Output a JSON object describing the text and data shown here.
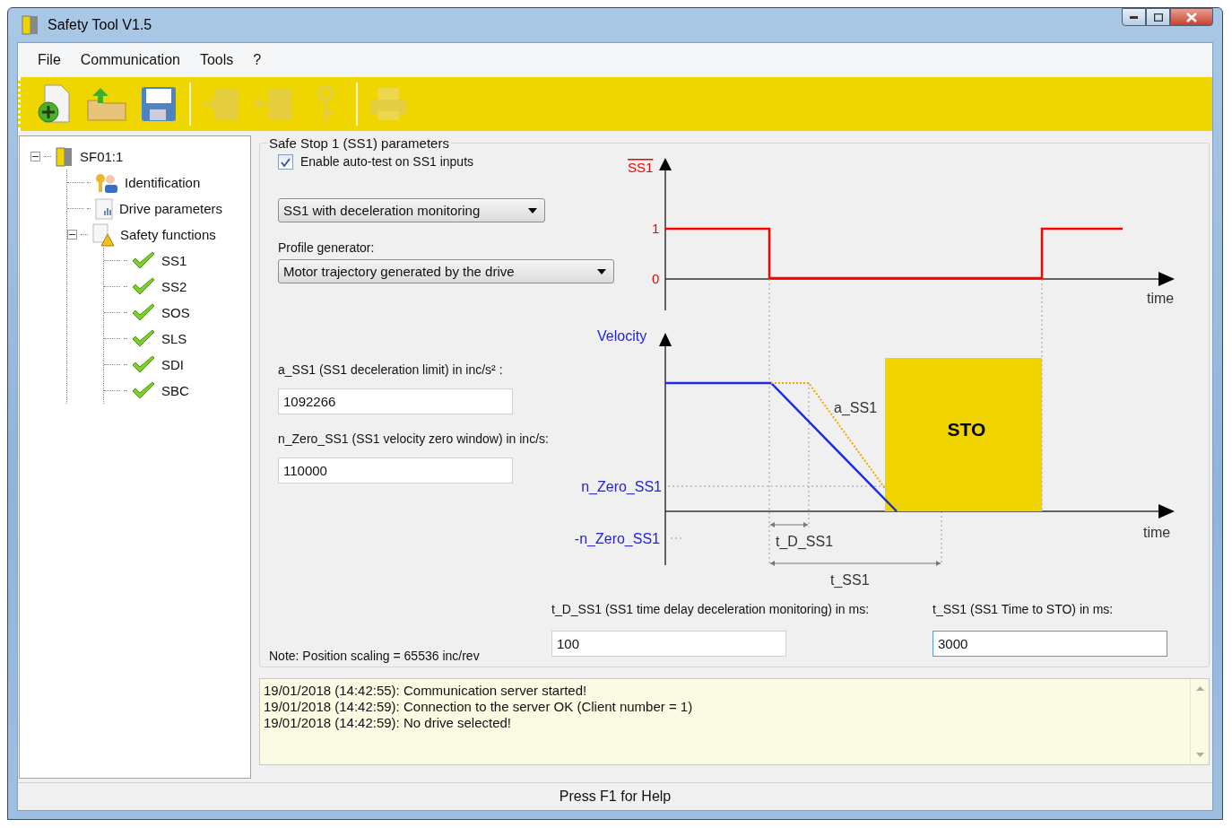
{
  "window": {
    "title": "Safety Tool V1.5"
  },
  "menu": [
    "File",
    "Communication",
    "Tools",
    "?"
  ],
  "toolbar": [
    {
      "kind": "new",
      "disabled": false
    },
    {
      "kind": "open",
      "disabled": false
    },
    {
      "kind": "save",
      "disabled": false
    },
    {
      "kind": "separator"
    },
    {
      "kind": "upload",
      "disabled": true
    },
    {
      "kind": "download",
      "disabled": true
    },
    {
      "kind": "key",
      "disabled": true
    },
    {
      "kind": "separator"
    },
    {
      "kind": "print",
      "disabled": true
    }
  ],
  "tree": {
    "label": "SF01:1",
    "kind": "drive",
    "expanded": true,
    "children": [
      {
        "label": "Identification",
        "kind": "identification"
      },
      {
        "label": "Drive parameters",
        "kind": "parameters"
      },
      {
        "label": "Safety functions",
        "kind": "functions",
        "expanded": true,
        "children": [
          {
            "label": "SS1",
            "kind": "function"
          },
          {
            "label": "SS2",
            "kind": "function"
          },
          {
            "label": "SOS",
            "kind": "function"
          },
          {
            "label": "SLS",
            "kind": "function"
          },
          {
            "label": "SDI",
            "kind": "function"
          },
          {
            "label": "SBC",
            "kind": "function"
          }
        ]
      }
    ]
  },
  "group": {
    "title": "Safe Stop 1 (SS1) parameters",
    "autotest": {
      "label": "Enable auto-test on SS1 inputs",
      "checked": true
    },
    "mode_select": {
      "value": "SS1 with deceleration monitoring"
    },
    "profile": {
      "label": "Profile generator:",
      "value": "Motor trajectory generated by the drive"
    },
    "fields": [
      {
        "label": "a_SS1 (SS1 deceleration limit) in inc/s² :",
        "value": "1092266"
      },
      {
        "label": "n_Zero_SS1 (SS1 velocity zero window) in inc/s:",
        "value": "110000"
      }
    ],
    "delay_fields": [
      {
        "label": "t_D_SS1 (SS1 time delay deceleration monitoring) in ms:",
        "value": "100",
        "focused": false
      },
      {
        "label": "t_SS1 (SS1 Time to STO) in ms:",
        "value": "3000",
        "focused": true
      }
    ],
    "note": "Note: Position scaling = 65536 inc/rev"
  },
  "diagram": {
    "signal_label": "SS1",
    "level_high": "1",
    "level_low": "0",
    "time_label_top": "time",
    "velocity_label": "Velocity",
    "slope_label": "a_SS1",
    "sto_label": "STO",
    "zero_label": "n_Zero_SS1",
    "neg_zero_label": "-n_Zero_SS1",
    "delay_label": "t_D_SS1",
    "time_label_bottom": "time",
    "stop_label": "t_SS1"
  },
  "log": [
    "19/01/2018 (14:42:55): Communication server started!",
    "19/01/2018 (14:42:59): Connection to the server OK (Client number = 1)",
    "19/01/2018 (14:42:59): No drive selected!"
  ],
  "status_bar": "Press F1 for Help"
}
